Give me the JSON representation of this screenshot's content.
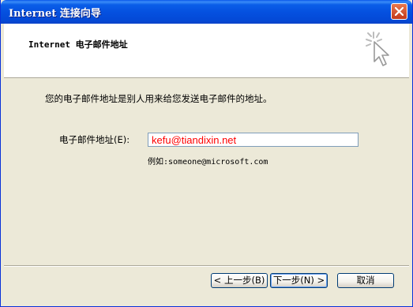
{
  "window": {
    "title": "Internet 连接向导",
    "header_title": "Internet 电子邮件地址"
  },
  "body": {
    "intro_text": "您的电子邮件地址是别人用来给您发送电子邮件的地址。",
    "email_label": "电子邮件地址(E):",
    "email_value": "kefu@tiandixin.net",
    "example_text": "例如:someone@microsoft.com"
  },
  "buttons": {
    "back_label": "< 上一步(B)",
    "next_label": "下一步(N) >",
    "cancel_label": "取消"
  },
  "colors": {
    "titlebar": "#0551e0",
    "dialog_bg": "#ece9d8",
    "input_text": "#ff0000",
    "close_button": "#c4391b"
  },
  "icons": {
    "close": "close-icon",
    "wizard": "wizard-cursor-icon"
  }
}
